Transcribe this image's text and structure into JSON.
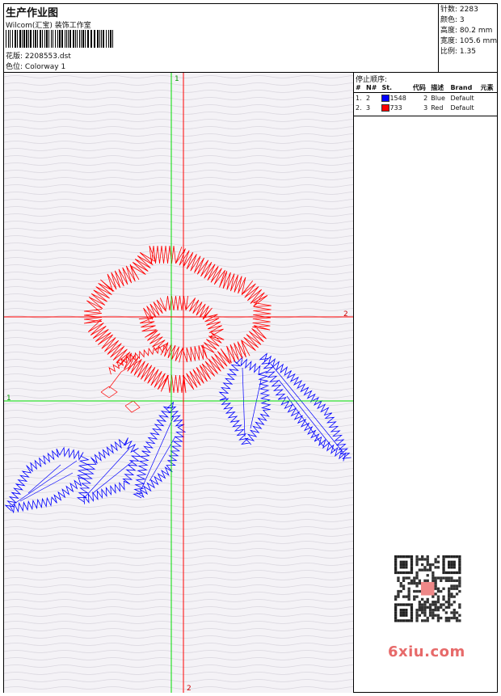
{
  "header": {
    "title": "生产作业图",
    "company": "Wilcom(汇宝) 装饰工作室",
    "design_label": "花版:",
    "design_value": "2208553.dst",
    "colorway_label": "色位:",
    "colorway_value": "Colorway 1"
  },
  "stats": [
    {
      "label": "针数:",
      "value": "2283"
    },
    {
      "label": "颜色:",
      "value": "3"
    },
    {
      "label": "高度:",
      "value": "80.2 mm"
    },
    {
      "label": "宽度:",
      "value": "105.6 mm"
    },
    {
      "label": "比例:",
      "value": "1.35"
    }
  ],
  "stop_sequence": {
    "title": "停止顺序:",
    "columns": [
      "#",
      "N#",
      "St.",
      "代码",
      "描述",
      "Brand",
      "元素"
    ],
    "rows": [
      {
        "idx": "1.",
        "n": "2",
        "color": "#0000ff",
        "st": "1548",
        "code": "2",
        "desc": "Blue",
        "brand": "Default",
        "el": ""
      },
      {
        "idx": "2.",
        "n": "3",
        "color": "#ff0000",
        "st": "733",
        "code": "3",
        "desc": "Red",
        "brand": "Default",
        "el": ""
      }
    ]
  },
  "axes": {
    "green_v_label": "1",
    "green_h_label": "1",
    "red_h_label": "2",
    "red_v_label": "2"
  },
  "watermark": {
    "text": "6xiu.com"
  },
  "colors": {
    "thread_blue": "#0000ff",
    "thread_red": "#ff0000",
    "axis_green": "#00dd00",
    "axis_red": "#ff0000"
  }
}
